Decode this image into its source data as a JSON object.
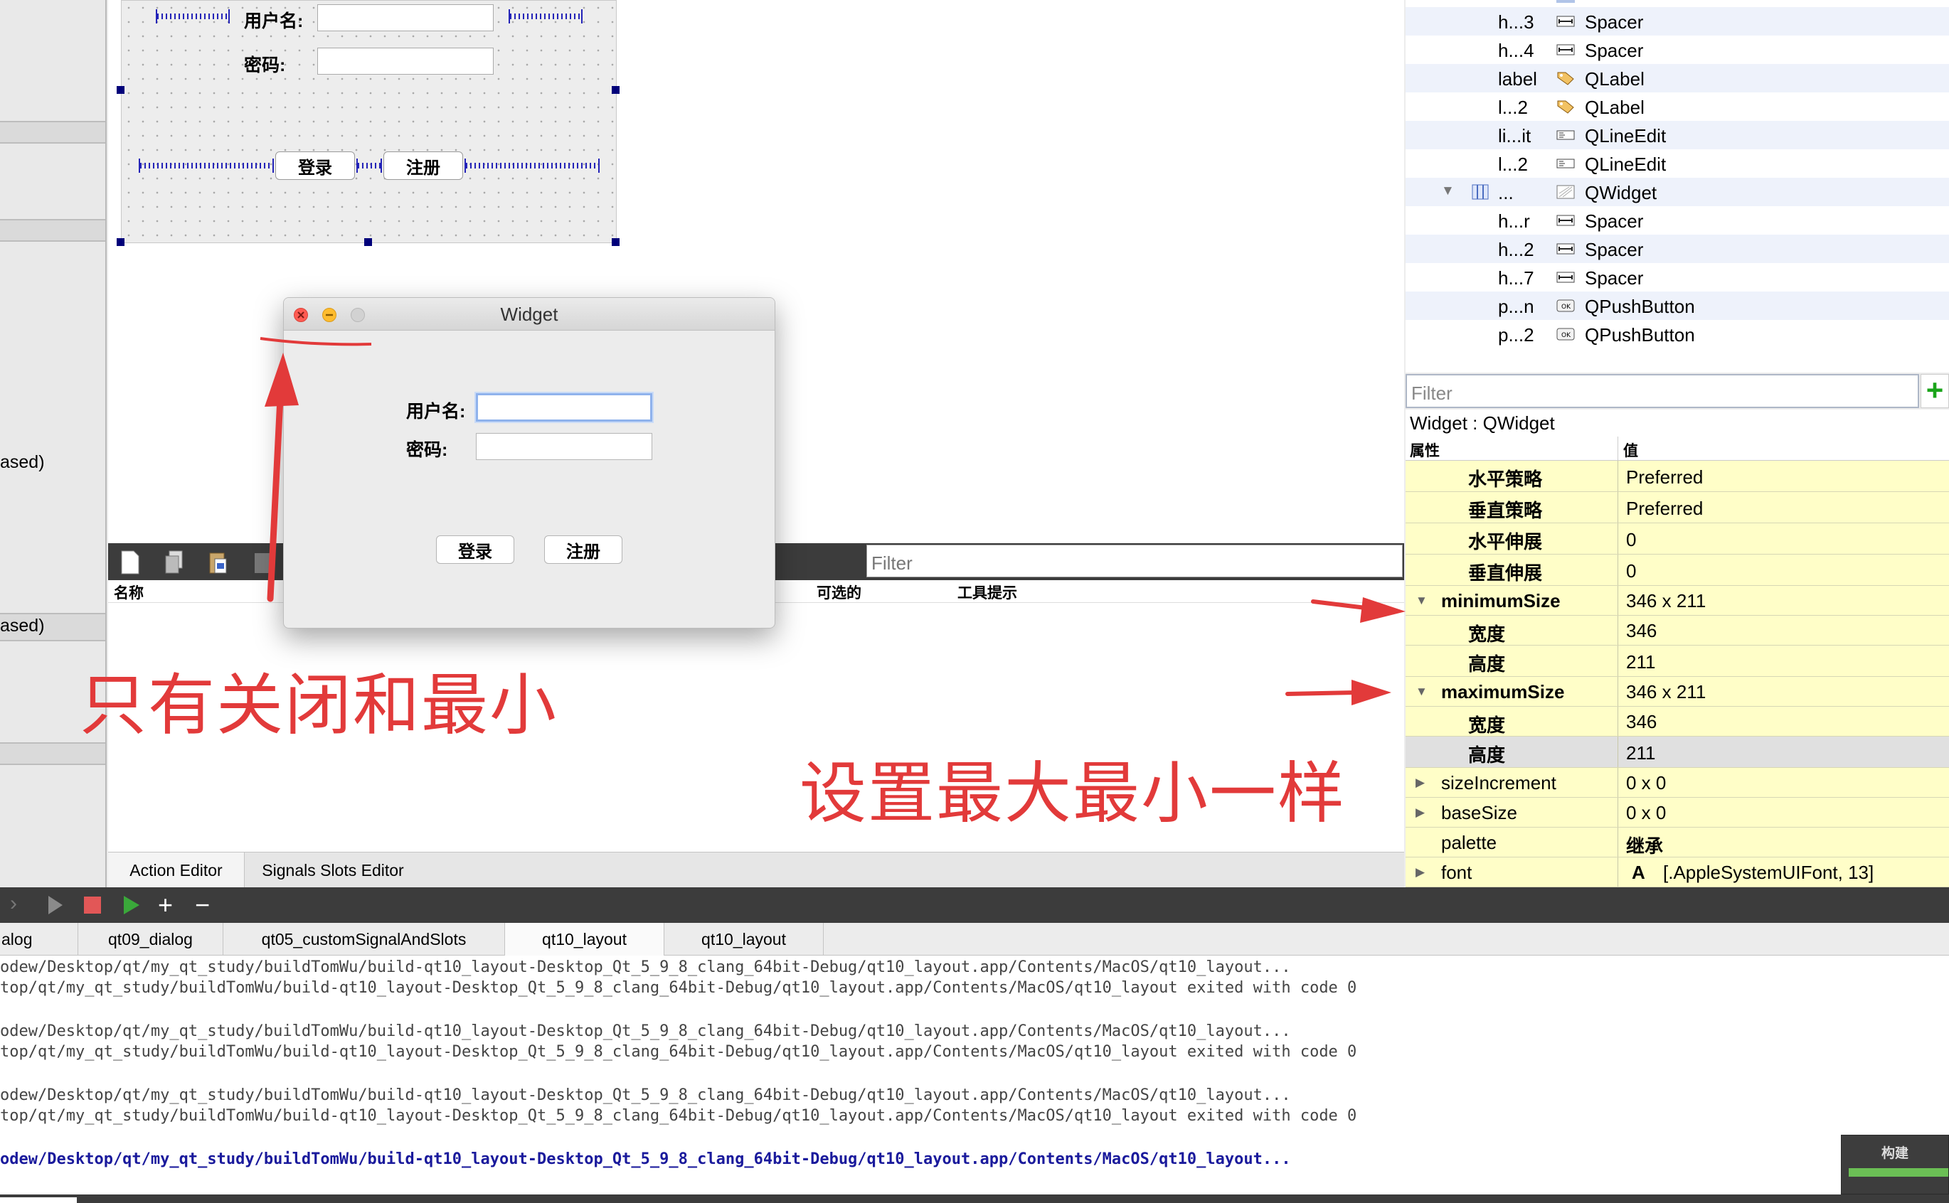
{
  "left_strip": {
    "text_1": "ased)",
    "text_2": "ased)"
  },
  "form": {
    "username_label": "用户名:",
    "password_label": "密码:",
    "login_button": "登录",
    "register_button": "注册"
  },
  "dialog": {
    "title": "Widget",
    "username_label": "用户名:",
    "password_label": "密码:",
    "login_button": "登录",
    "register_button": "注册"
  },
  "action_editor": {
    "filter_placeholder": "Filter",
    "headers": [
      "名称",
      "可选的",
      "工具提示"
    ],
    "tabs": [
      "Action Editor",
      "Signals  Slots Editor"
    ]
  },
  "object_tree": {
    "rows": [
      {
        "object": "h...3",
        "class": "Spacer",
        "icon": "spacer-icon"
      },
      {
        "object": "h...4",
        "class": "Spacer",
        "icon": "spacer-icon"
      },
      {
        "object": "label",
        "class": "QLabel",
        "icon": "label-tag-icon"
      },
      {
        "object": "l...2",
        "class": "QLabel",
        "icon": "label-tag-icon"
      },
      {
        "object": "li...it",
        "class": "QLineEdit",
        "icon": "line-edit-icon"
      },
      {
        "object": "l...2",
        "class": "QLineEdit",
        "icon": "line-edit-icon"
      },
      {
        "object": "...",
        "class": "QWidget",
        "icon": "widget-icon"
      },
      {
        "object": "h...r",
        "class": "Spacer",
        "icon": "spacer-icon"
      },
      {
        "object": "h...2",
        "class": "Spacer",
        "icon": "spacer-icon"
      },
      {
        "object": "h...7",
        "class": "Spacer",
        "icon": "spacer-icon"
      },
      {
        "object": "p...n",
        "class": "QPushButton",
        "icon": "push-button-icon"
      },
      {
        "object": "p...2",
        "class": "QPushButton",
        "icon": "push-button-icon"
      }
    ]
  },
  "property_editor": {
    "filter_placeholder": "Filter",
    "add_label": "+",
    "object_title": "Widget : QWidget",
    "header_property": "属性",
    "header_value": "值",
    "rows": [
      {
        "name": "水平策略",
        "value": "Preferred"
      },
      {
        "name": "垂直策略",
        "value": "Preferred"
      },
      {
        "name": "水平伸展",
        "value": "0"
      },
      {
        "name": "垂直伸展",
        "value": "0"
      },
      {
        "name": "minimumSize",
        "value": "346 x 211",
        "expander": "▼"
      },
      {
        "name": "宽度",
        "value": "346"
      },
      {
        "name": "高度",
        "value": "211"
      },
      {
        "name": "maximumSize",
        "value": "346 x 211",
        "expander": "▼"
      },
      {
        "name": "宽度",
        "value": "346"
      },
      {
        "name": "高度",
        "value": "211"
      },
      {
        "name": "sizeIncrement",
        "value": "0 x 0",
        "expander": "▶"
      },
      {
        "name": "baseSize",
        "value": "0 x 0",
        "expander": "▶"
      },
      {
        "name": "palette",
        "value": "继承"
      },
      {
        "name": "font",
        "value": "[.AppleSystemUIFont, 13]",
        "expander": "▶",
        "value_prefix": "A"
      }
    ]
  },
  "run_tabs": [
    "alog",
    "qt09_dialog",
    "qt05_customSignalAndSlots",
    "qt10_layout",
    "qt10_layout"
  ],
  "output_lines": [
    "odew/Desktop/qt/my_qt_study/buildTomWu/build-qt10_layout-Desktop_Qt_5_9_8_clang_64bit-Debug/qt10_layout.app/Contents/MacOS/qt10_layout...",
    "top/qt/my_qt_study/buildTomWu/build-qt10_layout-Desktop_Qt_5_9_8_clang_64bit-Debug/qt10_layout.app/Contents/MacOS/qt10_layout exited with code 0",
    "odew/Desktop/qt/my_qt_study/buildTomWu/build-qt10_layout-Desktop_Qt_5_9_8_clang_64bit-Debug/qt10_layout.app/Contents/MacOS/qt10_layout...",
    "top/qt/my_qt_study/buildTomWu/build-qt10_layout-Desktop_Qt_5_9_8_clang_64bit-Debug/qt10_layout.app/Contents/MacOS/qt10_layout exited with code 0",
    "odew/Desktop/qt/my_qt_study/buildTomWu/build-qt10_layout-Desktop_Qt_5_9_8_clang_64bit-Debug/qt10_layout.app/Contents/MacOS/qt10_layout...",
    "top/qt/my_qt_study/buildTomWu/build-qt10_layout-Desktop_Qt_5_9_8_clang_64bit-Debug/qt10_layout.app/Contents/MacOS/qt10_layout exited with code 0",
    "odew/Desktop/qt/my_qt_study/buildTomWu/build-qt10_layout-Desktop_Qt_5_9_8_clang_64bit-Debug/qt10_layout.app/Contents/MacOS/qt10_layout..."
  ],
  "build": {
    "label": "构建"
  },
  "annotations": {
    "note_close_minimize": "只有关闭和最小",
    "note_same_size": "设置最大最小一样",
    "color": "#e23a3a"
  },
  "colors": {
    "property_bg": "#fffec8",
    "spacer": "#2323b8",
    "dark_toolbar": "#3c3c3c"
  }
}
